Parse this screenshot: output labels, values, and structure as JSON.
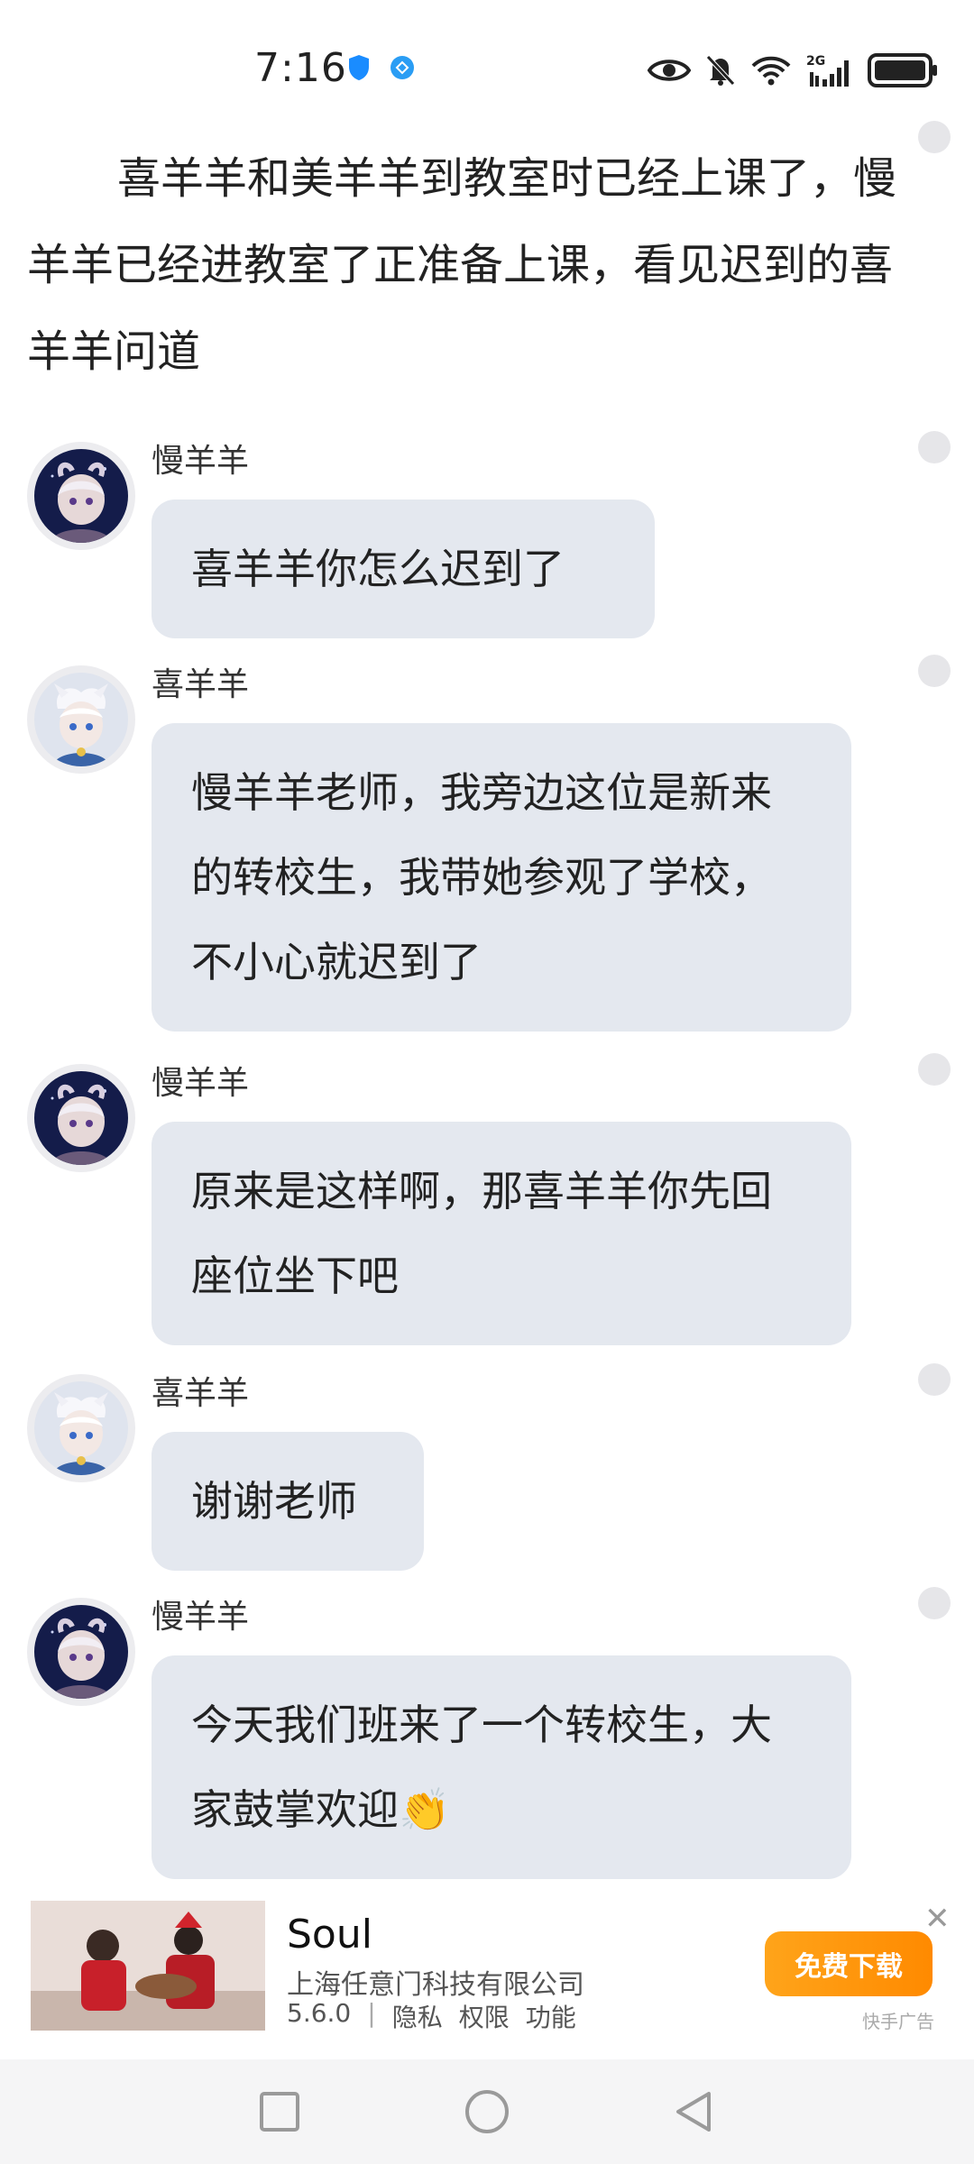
{
  "status_bar": {
    "time": "7:16",
    "left_icons": [
      "shield-icon",
      "app-notification-icon"
    ],
    "right_icons": [
      "eye-icon",
      "mute-bell-icon",
      "wifi-icon",
      "cellular-2g-icon",
      "battery-icon"
    ],
    "network": "2G"
  },
  "story": {
    "narration": "喜羊羊和美羊羊到教室时已经上课了，慢羊羊已经进教室了正准备上课，看见迟到的喜羊羊问道"
  },
  "messages": [
    {
      "sender": "慢羊羊",
      "text": "喜羊羊你怎么迟到了"
    },
    {
      "sender": "喜羊羊",
      "text": "慢羊羊老师，我旁边这位是新来的转校生，我带她参观了学校，不小心就迟到了"
    },
    {
      "sender": "慢羊羊",
      "text": "原来是这样啊，那喜羊羊你先回座位坐下吧"
    },
    {
      "sender": "喜羊羊",
      "text": "谢谢老师"
    },
    {
      "sender": "慢羊羊",
      "text": "今天我们班来了一个转校生，大家鼓掌欢迎👏"
    }
  ],
  "ad": {
    "app_name": "Soul",
    "company": "上海任意门科技有限公司",
    "version": "5.6.0",
    "links": [
      "隐私",
      "权限",
      "功能"
    ],
    "button_label": "免费下载",
    "source_label": "快手广告",
    "close_symbol": "✕"
  },
  "nav_bar": {
    "buttons": [
      "recent-apps-icon",
      "home-icon",
      "back-icon"
    ]
  },
  "colors": {
    "bubble": "#e4e8ef",
    "ad_button": "#ff9a0d",
    "background": "#ffffff"
  }
}
